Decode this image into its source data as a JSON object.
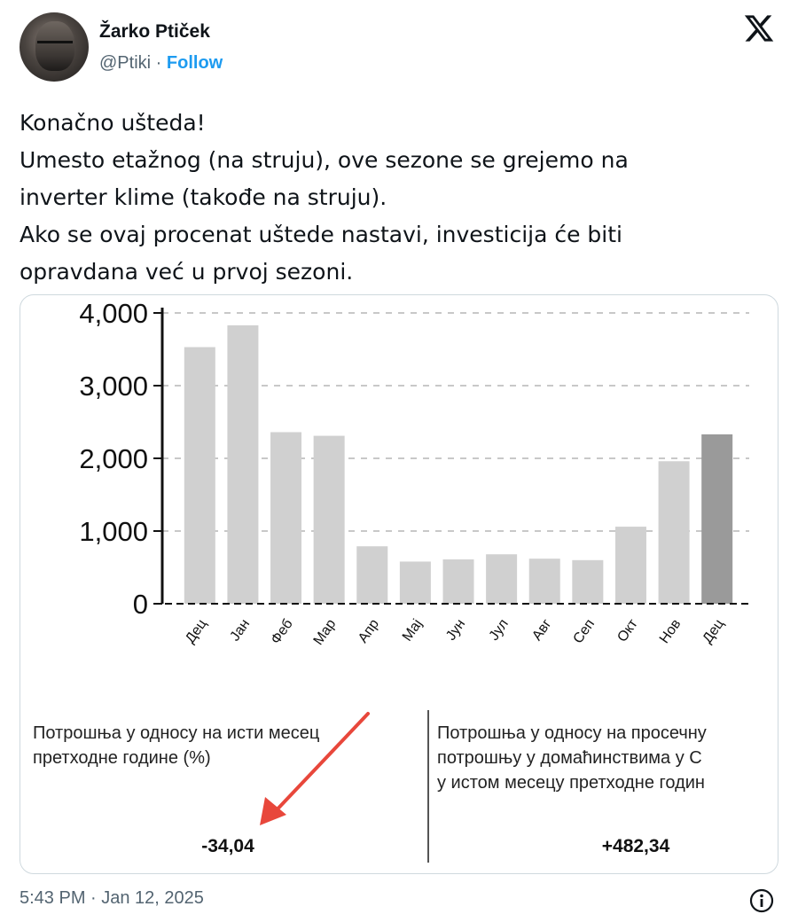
{
  "user": {
    "name": "Žarko Ptiček",
    "handle": "@Ptiki",
    "separator": "·",
    "follow_label": "Follow"
  },
  "tweet": {
    "text": "Konačno ušteda!\nUmesto etažnog (na struju), ove sezone se grejemo na\ninverter klime (takođe na struju).\nAko se ovaj procenat uštede nastavi, investicija će biti\nopravdana već u prvoj sezoni.",
    "timestamp": "5:43 PM · Jan 12, 2025"
  },
  "chart_data": {
    "type": "bar",
    "categories": [
      "Дец",
      "Јан",
      "Феб",
      "Мар",
      "Апр",
      "Мај",
      "Јун",
      "Јул",
      "Авг",
      "Сеп",
      "Окт",
      "Нов",
      "Дец"
    ],
    "values": [
      3530,
      3830,
      2360,
      2310,
      790,
      580,
      610,
      680,
      620,
      600,
      1060,
      1960,
      2330
    ],
    "highlight_index": 12,
    "ylim": [
      0,
      4000
    ],
    "yticks": [
      0,
      1000,
      2000,
      3000,
      4000
    ],
    "ytick_labels": [
      "0",
      "1,000",
      "2,000",
      "3,000",
      "4,000"
    ],
    "grid": "horizontal dashed",
    "colors": {
      "bar": "#d0d0d0",
      "highlight": "#9a9a9a",
      "axis": "#111111",
      "grid": "#c8c8c8"
    }
  },
  "stats": {
    "left_label_lines": [
      "Потрошња у односу на исти месец",
      "претходне године (%)"
    ],
    "left_value": "-34,04",
    "right_label_lines": [
      "Потрошња у односу на просечну",
      "потрошњу у домаћинствима у С",
      "у истом месецу претходне годин"
    ],
    "right_value": "+482,34",
    "arrow_color": "#e8473b"
  },
  "icons": {
    "logo": "x-logo-icon",
    "info": "info-icon"
  }
}
